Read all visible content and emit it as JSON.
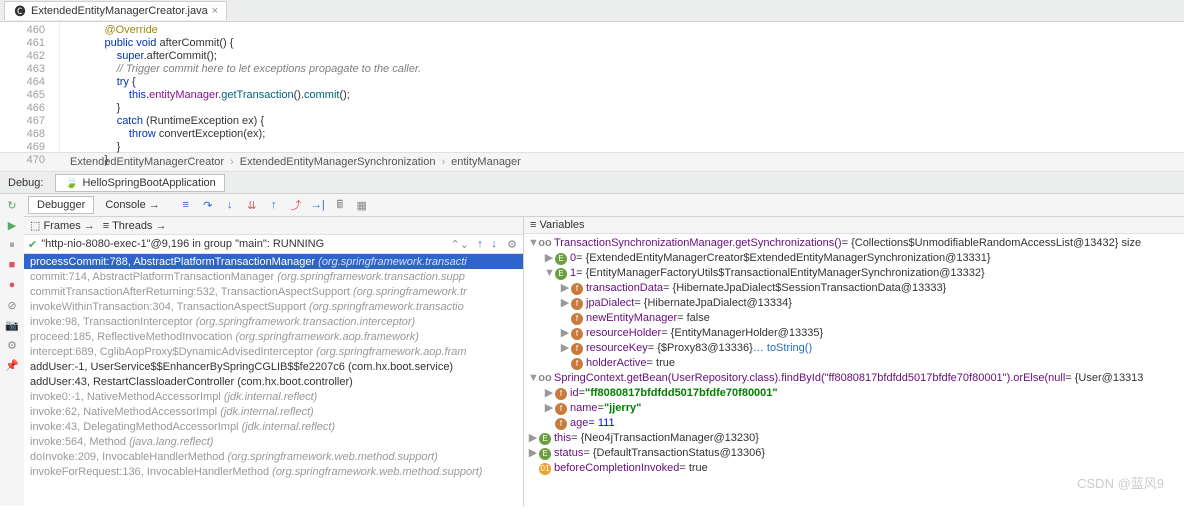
{
  "tab": {
    "filename": "ExtendedEntityManagerCreator.java"
  },
  "code": {
    "lines": [
      "460",
      "461",
      "462",
      "463",
      "464",
      "465",
      "466",
      "467",
      "468",
      "469",
      "470"
    ]
  },
  "breadcrumb": [
    "ExtendedEntityManagerCreator",
    "ExtendedEntityManagerSynchronization",
    "entityManager"
  ],
  "debug": {
    "label": "Debug:",
    "runConfig": "HelloSpringBootApplication",
    "tabDebugger": "Debugger",
    "tabConsole": "Console",
    "framesLabel": "Frames",
    "threadsLabel": "Threads",
    "thread": "\"http-nio-8080-exec-1\"@9,196 in group \"main\": RUNNING",
    "varsLabel": "Variables"
  },
  "frames": [
    {
      "sel": true,
      "m": "processCommit:788, AbstractPlatformTransactionManager",
      "p": "(org.springframework.transacti"
    },
    {
      "lib": true,
      "m": "commit:714, AbstractPlatformTransactionManager",
      "p": "(org.springframework.transaction.supp"
    },
    {
      "lib": true,
      "m": "commitTransactionAfterReturning:532, TransactionAspectSupport",
      "p": "(org.springframework.tr"
    },
    {
      "lib": true,
      "m": "invokeWithinTransaction:304, TransactionAspectSupport",
      "p": "(org.springframework.transactio"
    },
    {
      "lib": true,
      "m": "invoke:98, TransactionInterceptor",
      "p": "(org.springframework.transaction.interceptor)"
    },
    {
      "lib": true,
      "m": "proceed:185, ReflectiveMethodInvocation",
      "p": "(org.springframework.aop.framework)"
    },
    {
      "lib": true,
      "m": "intercept:689, CglibAopProxy$DynamicAdvisedInterceptor",
      "p": "(org.springframework.aop.fram"
    },
    {
      "m": "addUser:-1, UserService$$EnhancerBySpringCGLIB$$fe2207c6",
      "p": "(com.hx.boot.service)"
    },
    {
      "m": "addUser:43, RestartClassloaderController",
      "p": "(com.hx.boot.controller)"
    },
    {
      "lib": true,
      "m": "invoke0:-1, NativeMethodAccessorImpl",
      "p": "(jdk.internal.reflect)"
    },
    {
      "lib": true,
      "m": "invoke:62, NativeMethodAccessorImpl",
      "p": "(jdk.internal.reflect)"
    },
    {
      "lib": true,
      "m": "invoke:43, DelegatingMethodAccessorImpl",
      "p": "(jdk.internal.reflect)"
    },
    {
      "lib": true,
      "m": "invoke:564, Method",
      "p": "(java.lang.reflect)"
    },
    {
      "lib": true,
      "m": "doInvoke:209, InvocableHandlerMethod",
      "p": "(org.springframework.web.method.support)"
    },
    {
      "lib": true,
      "m": "invokeForRequest:136, InvocableHandlerMethod",
      "p": "(org.springframework.web.method.support)"
    }
  ],
  "vars": {
    "r1": {
      "name": "TransactionSynchronizationManager.getSynchronizations()",
      "val": "= {Collections$UnmodifiableRandomAccessList@13432}  size"
    },
    "r2": {
      "name": "0",
      "val": "= {ExtendedEntityManagerCreator$ExtendedEntityManagerSynchronization@13331}"
    },
    "r3": {
      "name": "1",
      "val": "= {EntityManagerFactoryUtils$TransactionalEntityManagerSynchronization@13332}"
    },
    "r4": {
      "name": "transactionData",
      "val": "= {HibernateJpaDialect$SessionTransactionData@13333}"
    },
    "r5": {
      "name": "jpaDialect",
      "val": "= {HibernateJpaDialect@13334}"
    },
    "r6": {
      "name": "newEntityManager",
      "val": "= false"
    },
    "r7": {
      "name": "resourceHolder",
      "val": "= {EntityManagerHolder@13335}"
    },
    "r8": {
      "name": "resourceKey",
      "val": "= {$Proxy83@13336}",
      "link": "… toString()"
    },
    "r9": {
      "name": "holderActive",
      "val": "= true"
    },
    "r10": {
      "name": "SpringContext.getBean(UserRepository.class).findById(\"ff8080817bfdfdd5017bfdfe70f80001\").orElse(null",
      "val": "= {User@13313"
    },
    "r11": {
      "name": "id",
      "val": "= ",
      "str": "\"ff8080817bfdfdd5017bfdfe70f80001\""
    },
    "r12": {
      "name": "name",
      "val": "= ",
      "str": "\"jjerry\""
    },
    "r13": {
      "name": "age",
      "val": "= 111"
    },
    "r14": {
      "name": "this",
      "val": "= {Neo4jTransactionManager@13230}"
    },
    "r15": {
      "name": "status",
      "val": "= {DefaultTransactionStatus@13306}"
    },
    "r16": {
      "name": "beforeCompletionInvoked",
      "val": "= true"
    }
  },
  "watermark": "CSDN @蓝风9"
}
